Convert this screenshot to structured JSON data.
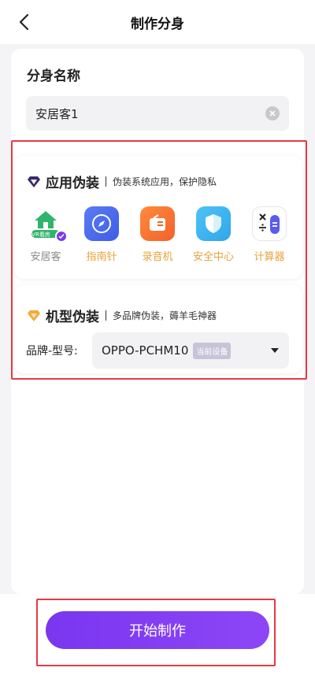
{
  "header": {
    "title": "制作分身"
  },
  "name_section": {
    "label": "分身名称",
    "value": "安居客1"
  },
  "app_disguise": {
    "title": "应用伪装",
    "subtitle": "伪装系统应用，保护隐私",
    "apps": [
      {
        "label": "安居客",
        "badge": "VR看房",
        "selected": true,
        "color": "#8a8a8a"
      },
      {
        "label": "指南针",
        "color": "#e9a23b"
      },
      {
        "label": "录音机",
        "color": "#e9a23b"
      },
      {
        "label": "安全中心",
        "color": "#e9a23b"
      },
      {
        "label": "计算器",
        "color": "#e9a23b"
      }
    ]
  },
  "device_disguise": {
    "title": "机型伪装",
    "subtitle": "多品牌伪装，薅羊毛神器",
    "brand_label": "品牌-型号:",
    "brand_value": "OPPO-PCHM10",
    "current_badge": "当前设备"
  },
  "footer": {
    "start_label": "开始制作"
  },
  "colors": {
    "accent": "#7b38f0",
    "highlight": "#e63946"
  }
}
